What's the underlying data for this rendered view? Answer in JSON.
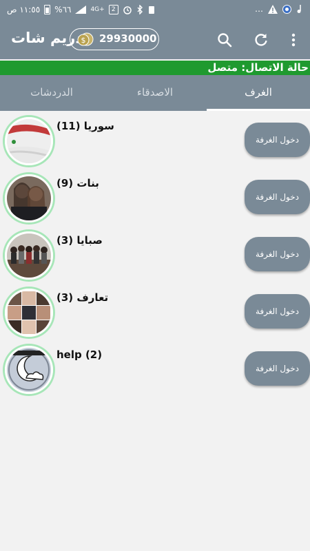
{
  "status_bar": {
    "time": "١١:٥٥ ص",
    "battery": "%٦٦",
    "network": "4G+",
    "sim_slot": "2",
    "icons": [
      "battery-icon",
      "signal-icon",
      "network-icon",
      "sim-icon",
      "alarm-icon",
      "bluetooth-icon",
      "usb-icon",
      "more-icon",
      "warning-icon",
      "shield-icon",
      "music-icon"
    ]
  },
  "app_bar": {
    "title": "دريم شات",
    "coins": "29930000",
    "icons": [
      "coins-icon",
      "search-icon",
      "refresh-icon",
      "overflow-menu-icon"
    ]
  },
  "connection_status": "حالة الاتصال: متصل",
  "tabs": [
    {
      "label": "الغرف",
      "active": true
    },
    {
      "label": "الاصدقاء",
      "active": false
    },
    {
      "label": "الدردشات",
      "active": false
    }
  ],
  "rooms": [
    {
      "name": "سوريا (11)",
      "button": "دخول الغرفة",
      "avatar": "syria-flag"
    },
    {
      "name": "بنات (9)",
      "button": "دخول الغرفة",
      "avatar": "photo"
    },
    {
      "name": "صبايا (3)",
      "button": "دخول الغرفة",
      "avatar": "group-photo"
    },
    {
      "name": "تعارف (3)",
      "button": "دخول الغرفة",
      "avatar": "collage"
    },
    {
      "name": "help (2)",
      "button": "دخول الغرفة",
      "avatar": "moon-cloud"
    }
  ],
  "colors": {
    "primary": "#7a8a97",
    "status_green": "#1f9a2f",
    "avatar_ring": "#a7e6b8",
    "background": "#f2f2f2"
  }
}
